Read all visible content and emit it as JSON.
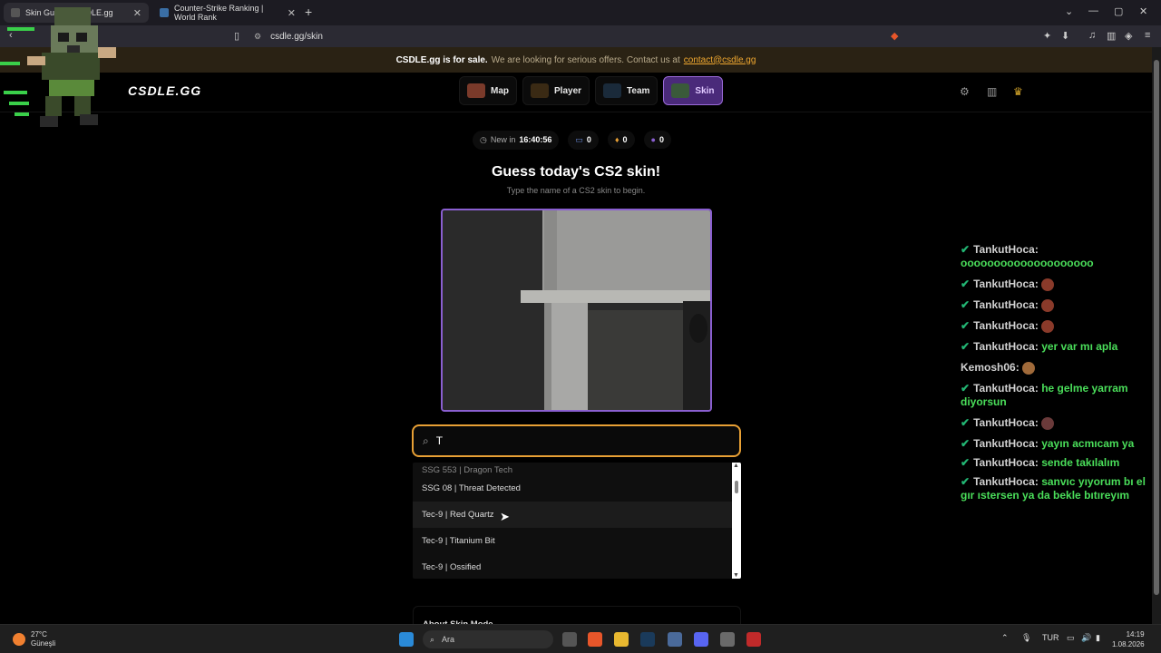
{
  "browser": {
    "tabs": [
      {
        "title": "Skin Guess · CSDLE.gg",
        "active": true
      },
      {
        "title": "Counter-Strike Ranking | World Rank",
        "active": false
      }
    ],
    "url": "csdle.gg/skin"
  },
  "banner": {
    "bold": "CSDLE.gg is for sale.",
    "text": "We are looking for serious offers. Contact us at",
    "email": "contact@csdle.gg"
  },
  "site": {
    "logo": "CSDLE.GG",
    "modes": [
      {
        "label": "Map",
        "active": false
      },
      {
        "label": "Player",
        "active": false
      },
      {
        "label": "Team",
        "active": false
      },
      {
        "label": "Skin",
        "active": true
      }
    ]
  },
  "status": {
    "new_in_label": "New in",
    "timer": "16:40:56",
    "stat1": "0",
    "stat2": "0",
    "stat3": "0"
  },
  "page": {
    "title": "Guess today's CS2 skin!",
    "subtitle": "Type the name of a CS2 skin to begin."
  },
  "search": {
    "value": "T"
  },
  "dropdown": {
    "items": [
      "SSG 553 | Dragon Tech",
      "SSG 08 | Threat Detected",
      "Tec-9 | Red Quartz",
      "Tec-9 | Titanium Bit",
      "Tec-9 | Ossified"
    ]
  },
  "about": {
    "title": "About Skin Mode"
  },
  "chat": [
    {
      "user": "TankutHoca",
      "text": "oooooooooooooooooooo",
      "badge": true
    },
    {
      "user": "TankutHoca",
      "text": "",
      "badge": true,
      "emote": true
    },
    {
      "user": "TankutHoca",
      "text": "",
      "badge": true,
      "emote": true
    },
    {
      "user": "TankutHoca",
      "text": "",
      "badge": true,
      "emote": true
    },
    {
      "user": "TankutHoca",
      "text": "yer var mı apla",
      "badge": true
    },
    {
      "user": "Kemosh06",
      "text": "",
      "badge": false,
      "emote": true
    },
    {
      "user": "TankutHoca",
      "text": "he gelme yarram diyorsun",
      "badge": true
    },
    {
      "user": "TankutHoca",
      "text": "",
      "badge": true,
      "emote": true
    },
    {
      "user": "TankutHoca",
      "text": "yayın acmıcam ya",
      "badge": true
    },
    {
      "user": "TankutHoca",
      "text": "sende takılalım",
      "badge": true
    },
    {
      "user": "TankutHoca",
      "text": "sanvıc yıyorum bı el gır ıstersen ya da bekle bıtıreyım",
      "badge": true
    }
  ],
  "taskbar": {
    "temperature": "27°C",
    "weather": "Güneşli",
    "search_placeholder": "Ara",
    "language": "TUR",
    "time": "14:19",
    "date": "1.08.2026"
  },
  "colors": {
    "accent_purple": "#8a5fd0",
    "search_border": "#e8a035",
    "chat_green": "#4ade5a"
  }
}
